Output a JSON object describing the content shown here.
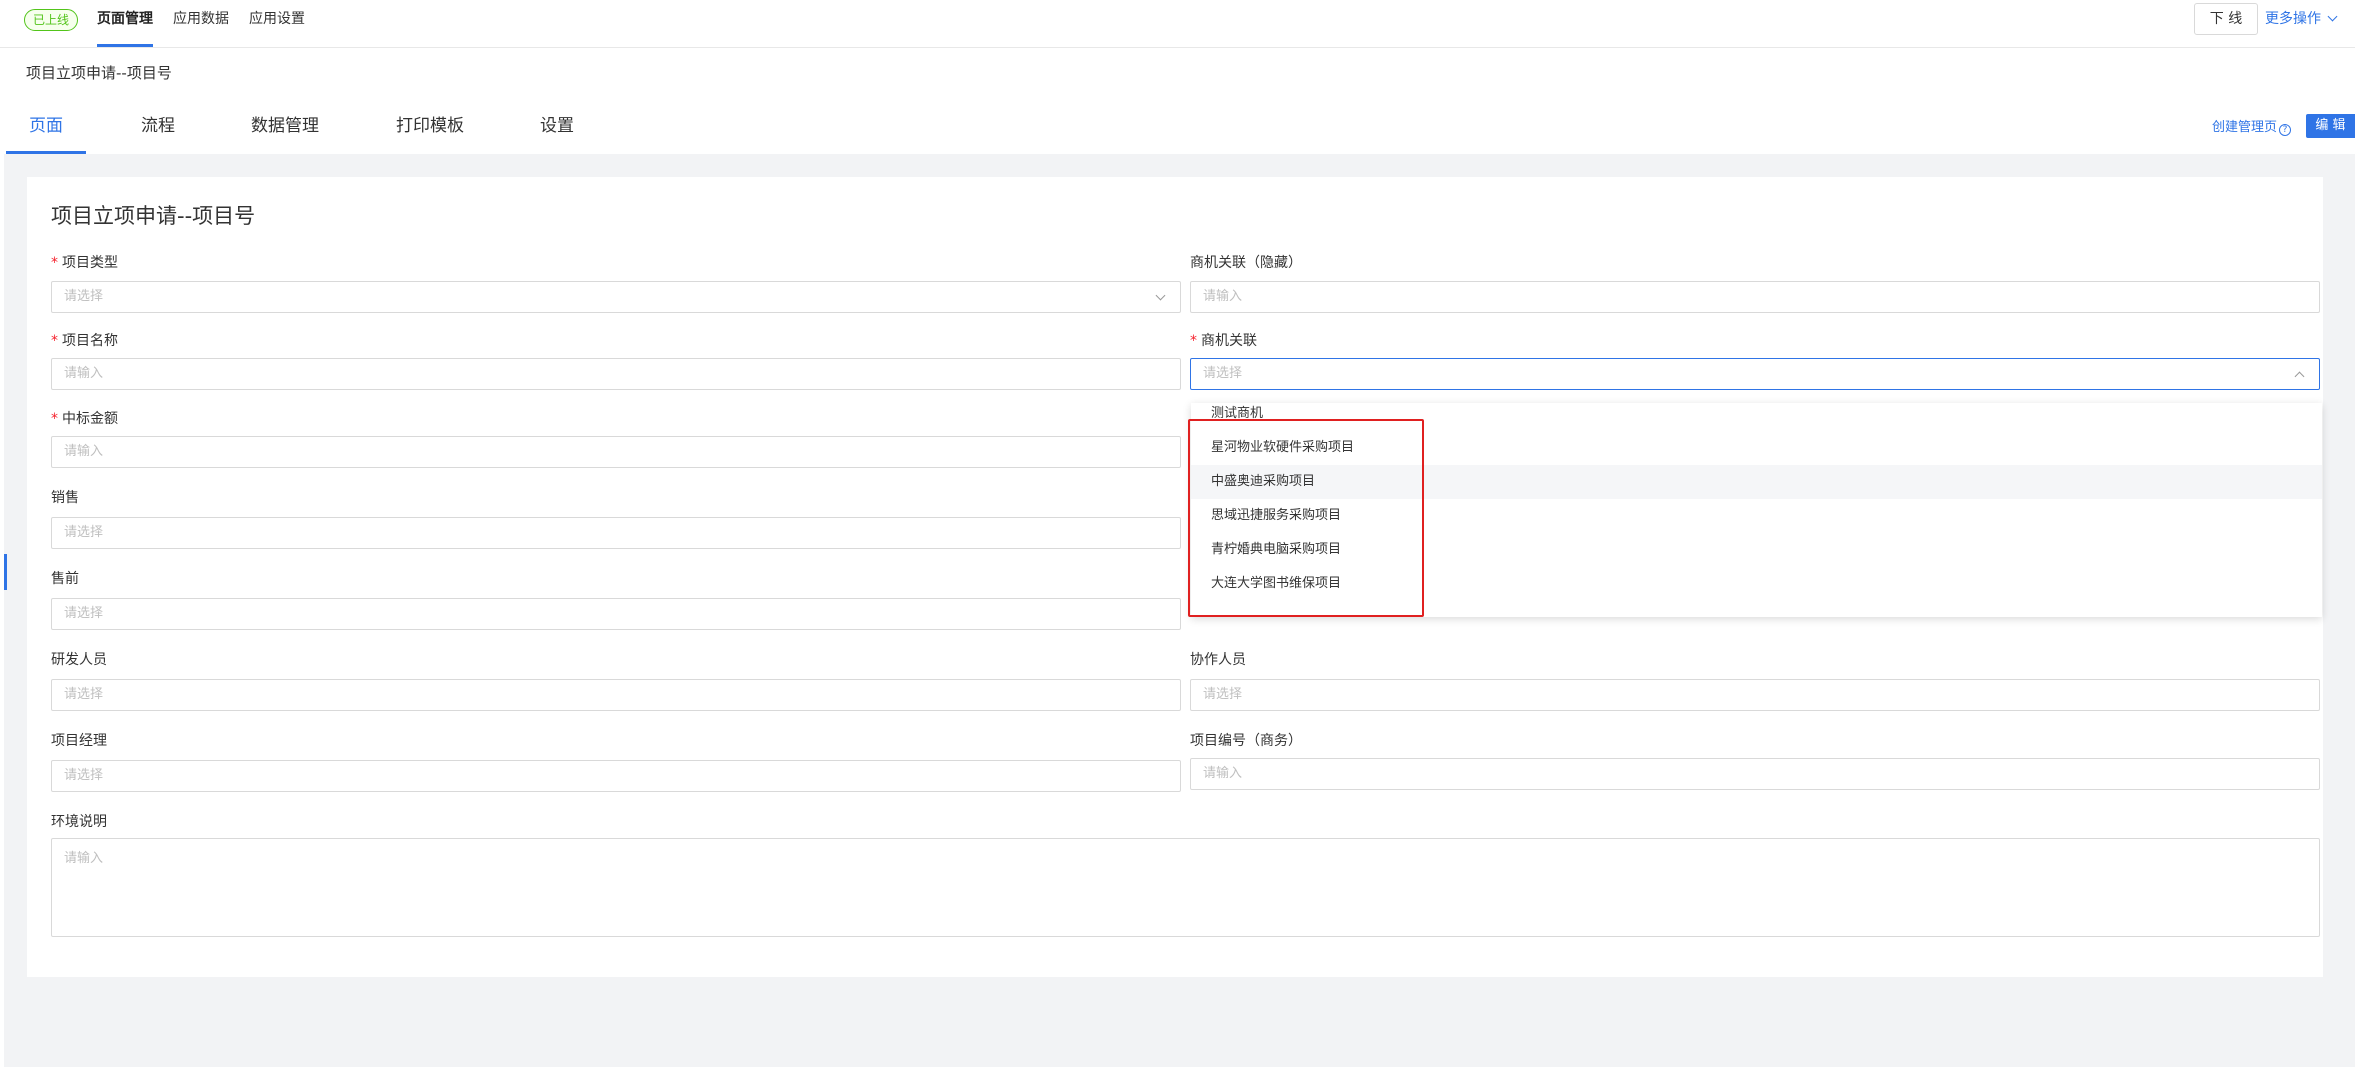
{
  "topbar": {
    "status": "已上线",
    "nav": [
      "页面管理",
      "应用数据",
      "应用设置"
    ],
    "offline_label": "下 线",
    "more_label": "更多操作"
  },
  "page": {
    "crumb_title": "项目立项申请--项目号",
    "tabs": [
      "页面",
      "流程",
      "数据管理",
      "打印模板",
      "设置"
    ],
    "create_mgr_label": "创建管理页",
    "edit_label": "编 辑"
  },
  "form": {
    "title": "项目立项申请--项目号",
    "fields": {
      "project_type": {
        "label": "项目类型",
        "placeholder": "请选择"
      },
      "biz_link_hidden": {
        "label": "商机关联（隐藏）",
        "placeholder": "请输入"
      },
      "project_name": {
        "label": "项目名称",
        "placeholder": "请输入"
      },
      "biz_link": {
        "label": "商机关联",
        "placeholder": "请选择"
      },
      "bid_amount": {
        "label": "中标金额",
        "placeholder": "请输入"
      },
      "sales": {
        "label": "销售",
        "placeholder": "请选择"
      },
      "presales": {
        "label": "售前",
        "placeholder": "请选择"
      },
      "developers": {
        "label": "研发人员",
        "placeholder": "请选择"
      },
      "collaborators": {
        "label": "协作人员",
        "placeholder": "请选择"
      },
      "project_manager": {
        "label": "项目经理",
        "placeholder": "请选择"
      },
      "project_code": {
        "label": "项目编号（商务）",
        "placeholder": "请输入"
      },
      "env_desc": {
        "label": "环境说明",
        "placeholder": "请输入"
      }
    }
  },
  "dropdown": {
    "items": [
      "测试商机",
      "星河物业软硬件采购项目",
      "中盛奥迪采购项目",
      "思域迅捷服务采购项目",
      "青柠婚典电脑采购项目",
      "大连大学图书维保项目"
    ]
  },
  "colors": {
    "accent": "#2f74e6",
    "required": "#f5222d",
    "highlight_box": "#e02020",
    "status": "#52c41a"
  }
}
